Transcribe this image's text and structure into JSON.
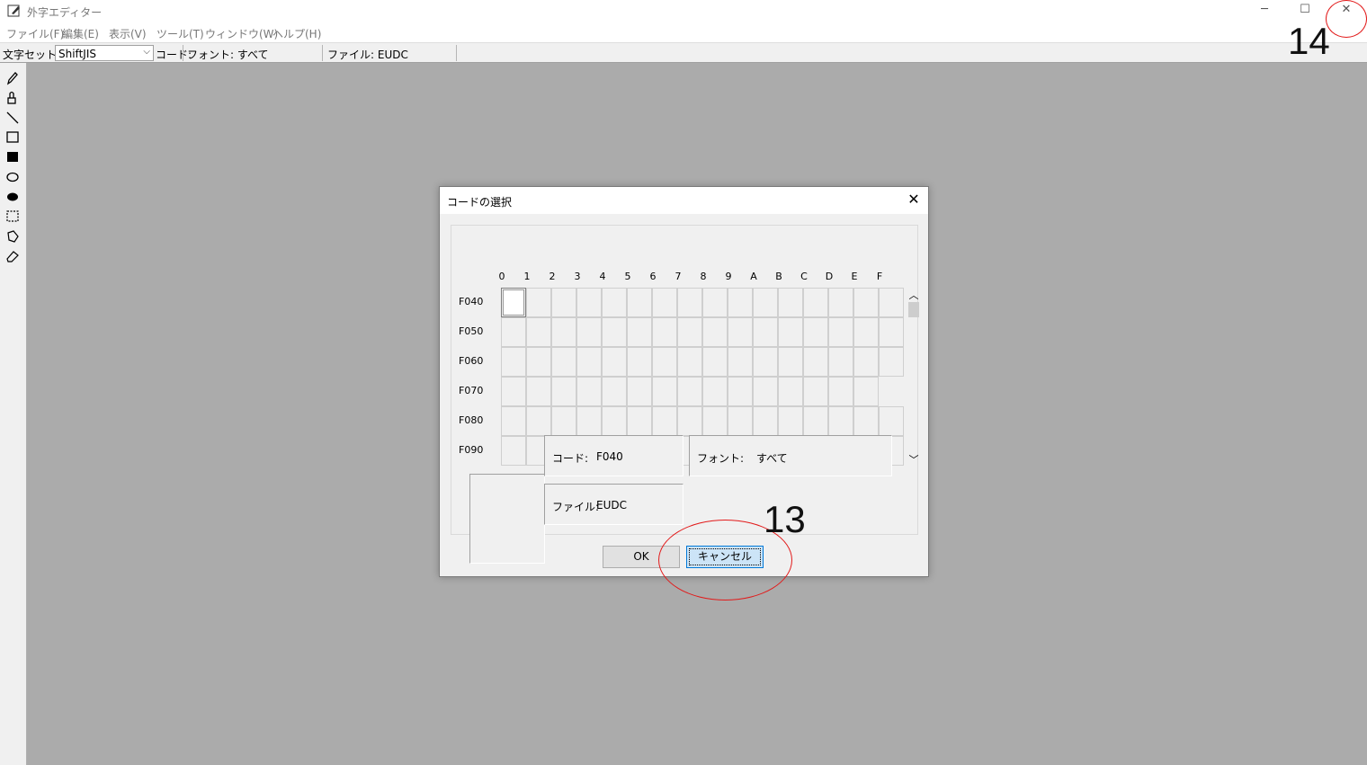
{
  "window": {
    "title": "外字エディター",
    "minimize_glyph": "─",
    "maximize_glyph": "☐",
    "close_glyph": "✕"
  },
  "menu": {
    "items": [
      "ファイル(F)",
      "編集(E)",
      "表示(V)",
      "ツール(T)",
      "ウィンドウ(W)",
      "ヘルプ(H)"
    ]
  },
  "toolbar": {
    "charset_label": "文字セット:",
    "charset_value": "ShiftJIS",
    "code_label": "コード:",
    "font_text": "フォント: すべて",
    "file_text": "ファイル: EUDC"
  },
  "tools": [
    "pencil-icon",
    "brush-icon",
    "line-icon",
    "rectangle-icon",
    "filled-rectangle-icon",
    "ellipse-icon",
    "filled-ellipse-icon",
    "rectangular-select-icon",
    "freeform-select-icon",
    "eraser-icon"
  ],
  "annotations": {
    "label_13": "13",
    "label_14": "14",
    "color": "#e21a1a"
  },
  "dialog": {
    "title": "コードの選択",
    "close_glyph": "✕",
    "columns": [
      "0",
      "1",
      "2",
      "3",
      "4",
      "5",
      "6",
      "7",
      "8",
      "9",
      "A",
      "B",
      "C",
      "D",
      "E",
      "F"
    ],
    "rows": [
      "F040",
      "F050",
      "F060",
      "F070",
      "F080",
      "F090"
    ],
    "selected_code": "F040",
    "code_label": "コード:",
    "code_value": "F040",
    "font_label": "フォント:",
    "font_value": "すべて",
    "file_label": "ファイル:",
    "file_value": "EUDC",
    "ok_label": "OK",
    "cancel_label": "キャンセル",
    "scroll_up_glyph": "︿",
    "scroll_down_glyph": "﹀"
  }
}
